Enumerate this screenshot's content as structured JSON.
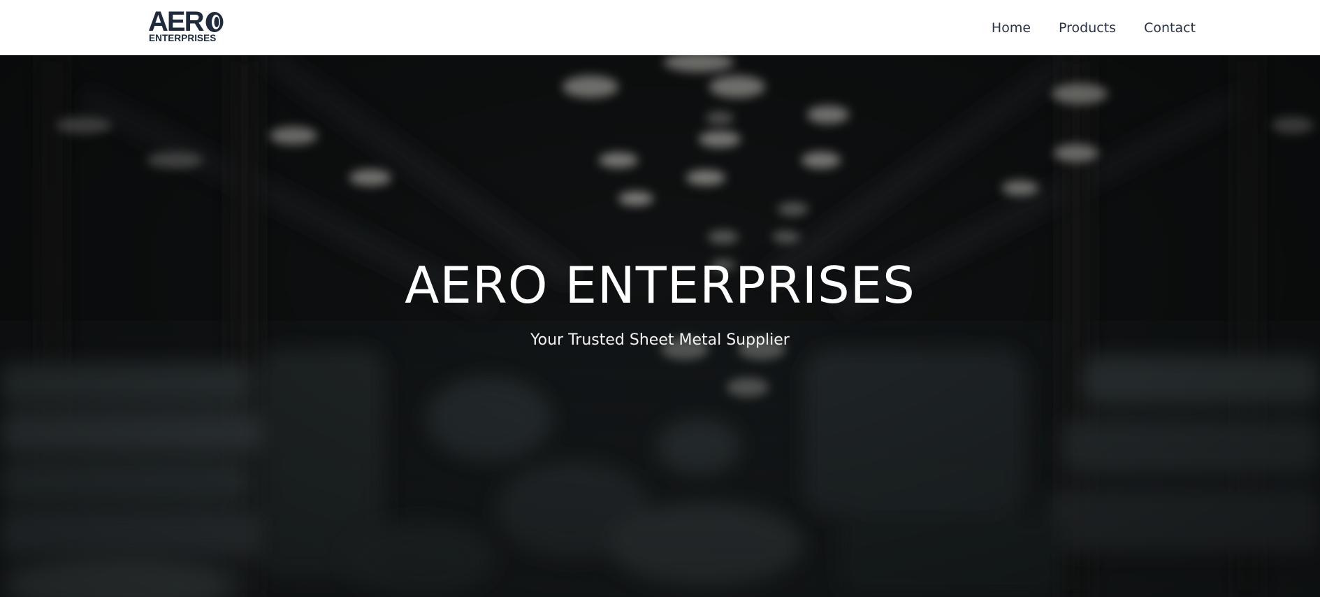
{
  "header": {
    "logo": {
      "word": "AER",
      "word_full": "AERO",
      "sub": "ENTERPRISES"
    },
    "nav": [
      {
        "label": "Home"
      },
      {
        "label": "Products"
      },
      {
        "label": "Contact"
      }
    ]
  },
  "hero": {
    "title": "AERO ENTERPRISES",
    "subtitle": "Your Trusted Sheet Metal Supplier",
    "background": "blurred warehouse-image"
  },
  "colors": {
    "header_bg": "#ffffff",
    "nav_text": "#2b3445",
    "logo": "#1f2a3c",
    "hero_text": "#ffffff"
  }
}
